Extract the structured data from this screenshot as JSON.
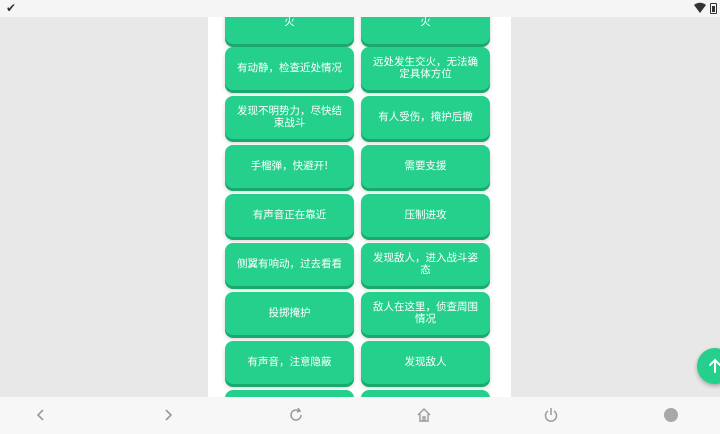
{
  "status_bar": {
    "left_icon": "check-icon",
    "right_icons": [
      "wifi-icon",
      "battery-icon"
    ]
  },
  "buttons": [
    {
      "label": "火",
      "column": "left"
    },
    {
      "label": "火",
      "column": "right"
    },
    {
      "label": "有动静，检查近处情况",
      "column": "left"
    },
    {
      "label": "远处发生交火，无法确定具体方位",
      "column": "right"
    },
    {
      "label": "发现不明势力，尽快结束战斗",
      "column": "left"
    },
    {
      "label": "有人受伤，掩护后撤",
      "column": "right"
    },
    {
      "label": "手榴弹，快避开!",
      "column": "left"
    },
    {
      "label": "需要支援",
      "column": "right"
    },
    {
      "label": "有声音正在靠近",
      "column": "left"
    },
    {
      "label": "压制进攻",
      "column": "right"
    },
    {
      "label": "侧翼有响动，过去看看",
      "column": "left"
    },
    {
      "label": "发现敌人，进入战斗姿态",
      "column": "right"
    },
    {
      "label": "投掷掩护",
      "column": "left"
    },
    {
      "label": "敌人在这里，侦查周围情况",
      "column": "right"
    },
    {
      "label": "有声音，注意隐蔽",
      "column": "left"
    },
    {
      "label": "发现敌人",
      "column": "right"
    },
    {
      "label": "",
      "column": "left"
    },
    {
      "label": "",
      "column": "right"
    }
  ],
  "fab": {
    "icon": "arrow-up-icon"
  },
  "nav_bar": {
    "icons": [
      "back-icon",
      "forward-icon",
      "refresh-icon",
      "home-icon",
      "power-icon",
      "circle-icon"
    ]
  },
  "colors": {
    "button": "#24d08c",
    "button_shadow": "#1aa86d",
    "panel": "#ffffff",
    "background": "#e8e8e8"
  }
}
